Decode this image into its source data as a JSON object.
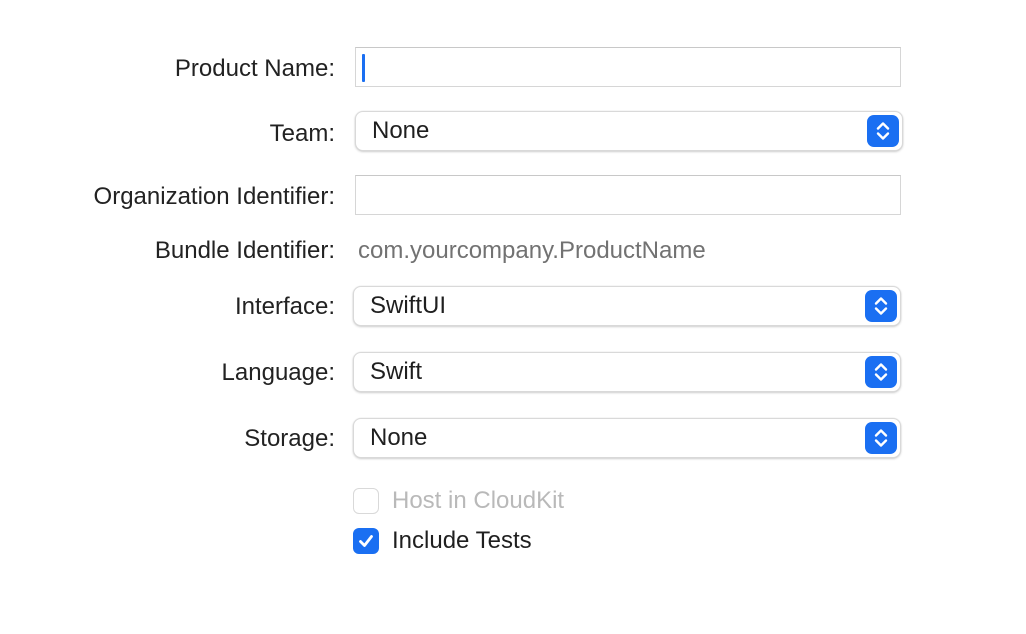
{
  "colors": {
    "accent": "#1a6ff2",
    "label": "#222222",
    "secondary_text": "#727272",
    "disabled_text": "#b9b9b9"
  },
  "form": {
    "product_name": {
      "label": "Product Name:",
      "value": ""
    },
    "team": {
      "label": "Team:",
      "value": "None"
    },
    "organization_identifier": {
      "label": "Organization Identifier:",
      "value": ""
    },
    "bundle_identifier": {
      "label": "Bundle Identifier:",
      "value": "com.yourcompany.ProductName"
    },
    "interface": {
      "label": "Interface:",
      "value": "SwiftUI"
    },
    "language": {
      "label": "Language:",
      "value": "Swift"
    },
    "storage": {
      "label": "Storage:",
      "value": "None"
    },
    "host_in_cloudkit": {
      "label": "Host in CloudKit",
      "checked": false,
      "enabled": false
    },
    "include_tests": {
      "label": "Include Tests",
      "checked": true,
      "enabled": true
    }
  },
  "icons": {
    "popup_stepper": "chevron-up-down-icon",
    "checkmark": "checkmark-icon"
  }
}
